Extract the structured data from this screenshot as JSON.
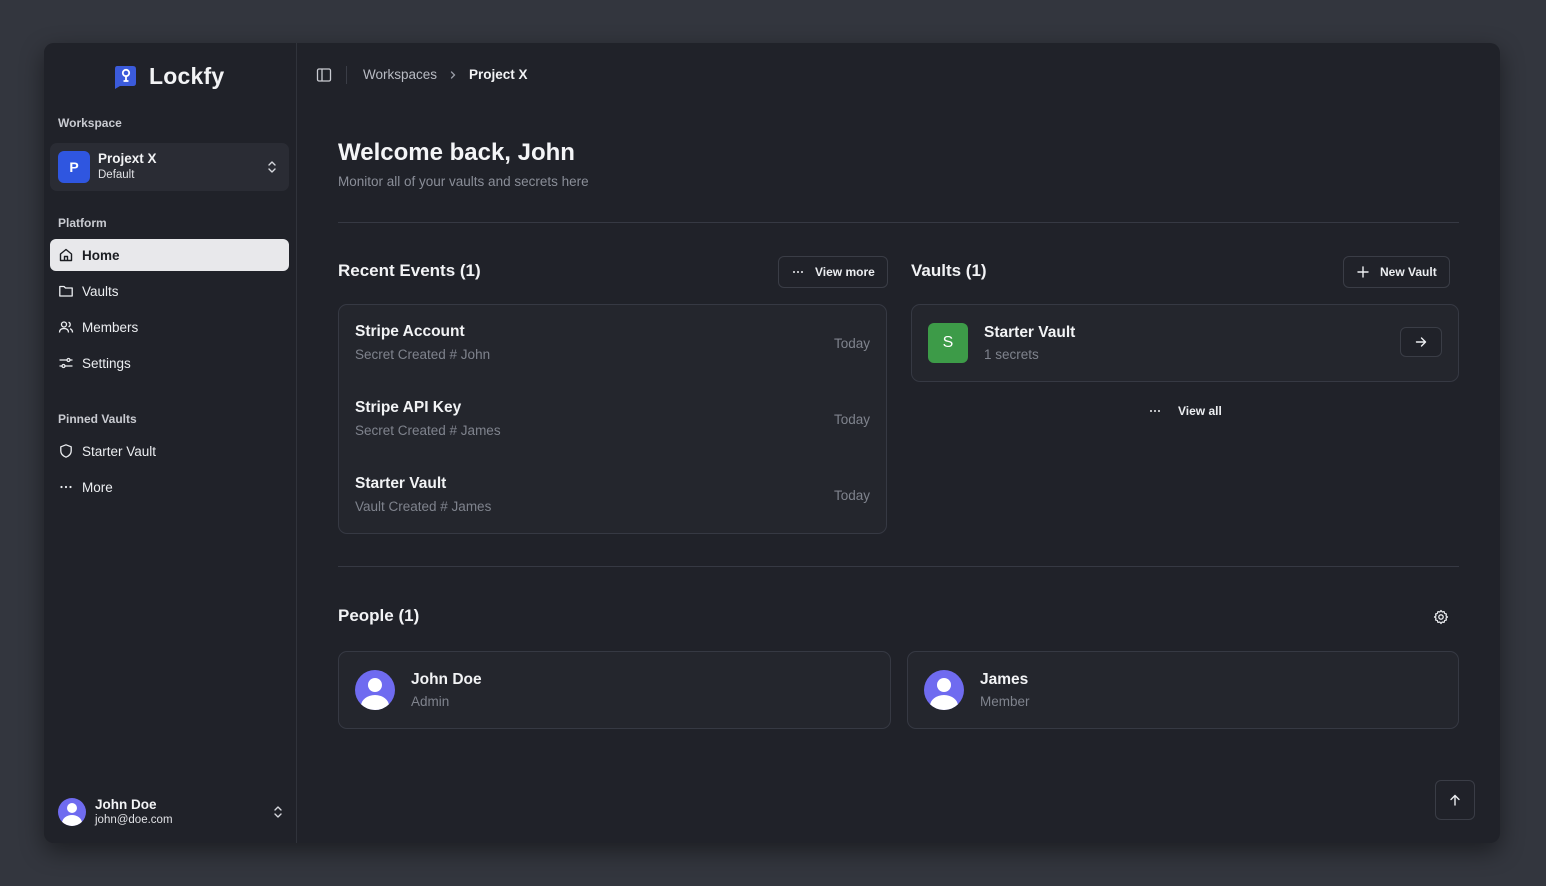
{
  "brand": {
    "name": "Lockfy",
    "accent": "#3b5bdb"
  },
  "sidebar": {
    "workspace_label": "Workspace",
    "workspace": {
      "badge": "P",
      "name": "Projext X",
      "sub": "Default"
    },
    "platform_label": "Platform",
    "nav": [
      {
        "label": "Home",
        "icon": "home-icon",
        "active": true
      },
      {
        "label": "Vaults",
        "icon": "folder-icon"
      },
      {
        "label": "Members",
        "icon": "users-icon"
      },
      {
        "label": "Settings",
        "icon": "sliders-icon"
      }
    ],
    "pinned_label": "Pinned Vaults",
    "pinned": [
      {
        "label": "Starter Vault",
        "icon": "shield-icon"
      },
      {
        "label": "More",
        "icon": "ellipsis-icon"
      }
    ],
    "user": {
      "name": "John Doe",
      "email": "john@doe.com"
    }
  },
  "topbar": {
    "breadcrumbs": [
      "Workspaces",
      "Project X"
    ]
  },
  "welcome": {
    "title": "Welcome back, John",
    "subtitle": "Monitor all of your vaults and secrets here"
  },
  "events": {
    "title": "Recent Events (1)",
    "view_more": "View more",
    "items": [
      {
        "title": "Stripe Account",
        "sub": "Secret Created # John",
        "time": "Today"
      },
      {
        "title": "Stripe API Key",
        "sub": "Secret Created # James",
        "time": "Today"
      },
      {
        "title": "Starter Vault",
        "sub": "Vault Created # James",
        "time": "Today"
      }
    ]
  },
  "vaults": {
    "title": "Vaults (1)",
    "new_vault": "New Vault",
    "items": [
      {
        "badge": "S",
        "name": "Starter Vault",
        "sub": "1 secrets",
        "color": "#3d9b48"
      }
    ],
    "view_all": "View all"
  },
  "people": {
    "title": "People (1)",
    "items": [
      {
        "name": "John Doe",
        "role": "Admin"
      },
      {
        "name": "James",
        "role": "Member"
      }
    ]
  }
}
